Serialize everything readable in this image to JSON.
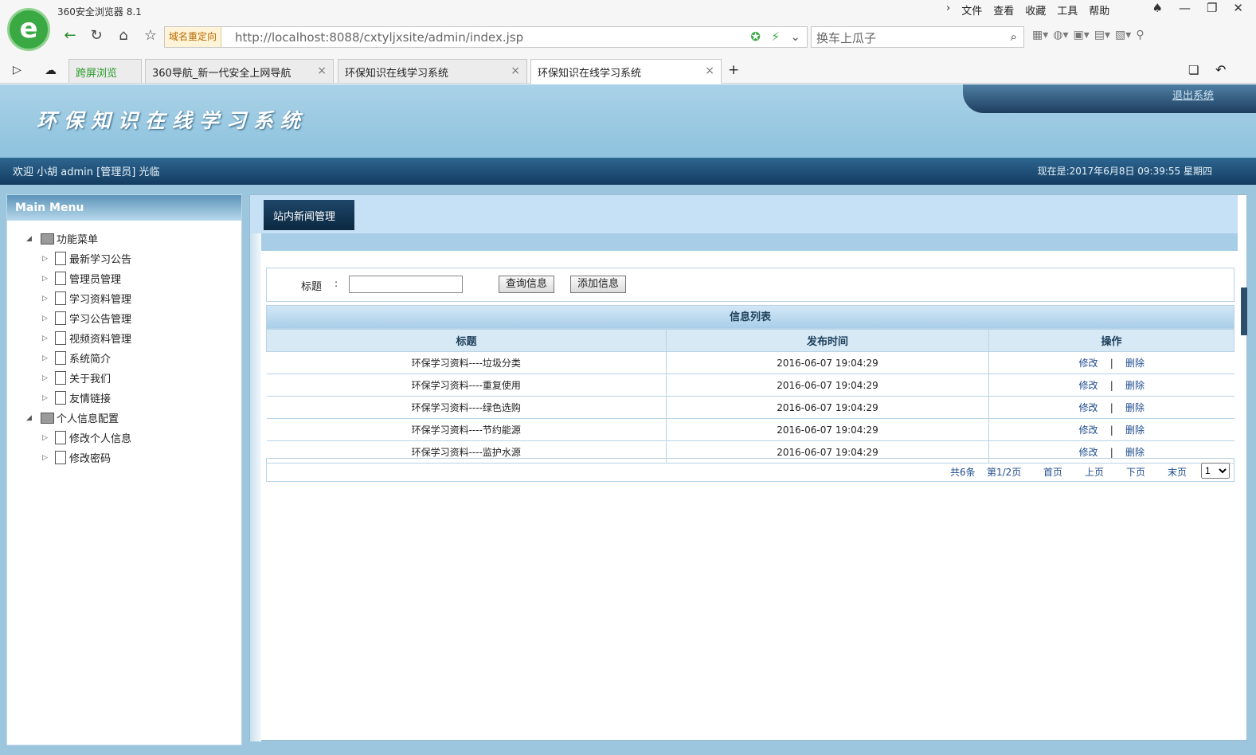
{
  "browser": {
    "app_title": "360安全浏览器 8.1",
    "menu": [
      "文件",
      "查看",
      "收藏",
      "工具",
      "帮助"
    ],
    "redirect_label": "域名重定向",
    "url": "http://localhost:8088/cxtyljxsite/admin/index.jsp",
    "search_text": "换车上瓜子",
    "tabs": [
      {
        "label": "跨屏浏览"
      },
      {
        "label": "360导航_新一代安全上网导航"
      },
      {
        "label": "环保知识在线学习系统"
      },
      {
        "label": "环保知识在线学习系统"
      }
    ]
  },
  "header": {
    "site_title": "环保知识在线学习系统",
    "logout": "退出系统",
    "welcome": "欢迎 小胡   admin [管理员] 光临",
    "datetime": "现在是:2017年6月8日 09:39:55 星期四"
  },
  "sidebar": {
    "title": "Main Menu",
    "groups": [
      {
        "label": "功能菜单",
        "items": [
          "最新学习公告",
          "管理员管理",
          "学习资料管理",
          "学习公告管理",
          "视频资料管理",
          "系统简介",
          "关于我们",
          "友情链接"
        ]
      },
      {
        "label": "个人信息配置",
        "items": [
          "修改个人信息",
          "修改密码"
        ]
      }
    ]
  },
  "main": {
    "tab": "站内新闻管理",
    "search_label": "标题",
    "search_colon": ":",
    "search_value": "",
    "query_button": "查询信息",
    "add_button": "添加信息",
    "table": {
      "caption": "信息列表",
      "headers": [
        "标题",
        "发布时间",
        "操作"
      ],
      "rows": [
        {
          "title": "环保学习资料----垃圾分类",
          "time": "2016-06-07 19:04:29"
        },
        {
          "title": "环保学习资料----重复使用",
          "time": "2016-06-07 19:04:29"
        },
        {
          "title": "环保学习资料----绿色选购",
          "time": "2016-06-07 19:04:29"
        },
        {
          "title": "环保学习资料----节约能源",
          "time": "2016-06-07 19:04:29"
        },
        {
          "title": "环保学习资料----监护水源",
          "time": "2016-06-07 19:04:29"
        }
      ],
      "edit_label": "修改",
      "sep": "|",
      "delete_label": "删除"
    },
    "pager": {
      "total": "共6条",
      "page": "第1/2页",
      "first": "首页",
      "prev": "上页",
      "next": "下页",
      "last": "末页",
      "select": "1"
    }
  }
}
